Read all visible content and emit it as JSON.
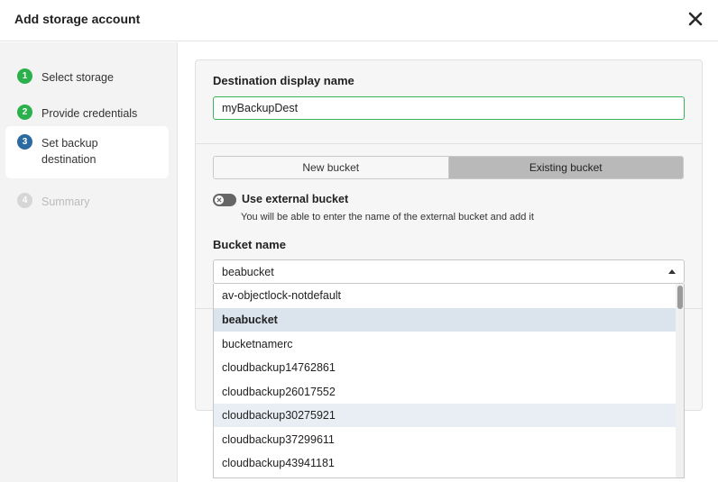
{
  "dialog": {
    "title": "Add storage account"
  },
  "steps": [
    {
      "number": "1",
      "label": "Select storage",
      "state": "done"
    },
    {
      "number": "2",
      "label": "Provide credentials",
      "state": "done"
    },
    {
      "number": "3",
      "label": "Set backup destination",
      "state": "active"
    },
    {
      "number": "4",
      "label": "Summary",
      "state": "disabled"
    }
  ],
  "destination": {
    "label": "Destination display name",
    "value": "myBackupDest"
  },
  "bucket_type": {
    "options": [
      "New bucket",
      "Existing bucket"
    ],
    "selected": "Existing bucket"
  },
  "external_bucket": {
    "label": "Use external bucket",
    "description": "You will be able to enter the name of the external bucket and add it",
    "enabled": false
  },
  "bucket_name": {
    "label": "Bucket name",
    "value": "beabucket",
    "options": [
      "av-objectlock-notdefault",
      "beabucket",
      "bucketnamerc",
      "cloudbackup14762861",
      "cloudbackup26017552",
      "cloudbackup30275921",
      "cloudbackup37299611",
      "cloudbackup43941181"
    ],
    "selected_index": 1,
    "hovered_index": 5
  },
  "colors": {
    "step_done": "#2bb14c",
    "step_active": "#2b6aa0",
    "input_focus_border": "#3cb45a",
    "segment_selected": "#b9b9b9",
    "option_selected": "#dbe3ec"
  }
}
